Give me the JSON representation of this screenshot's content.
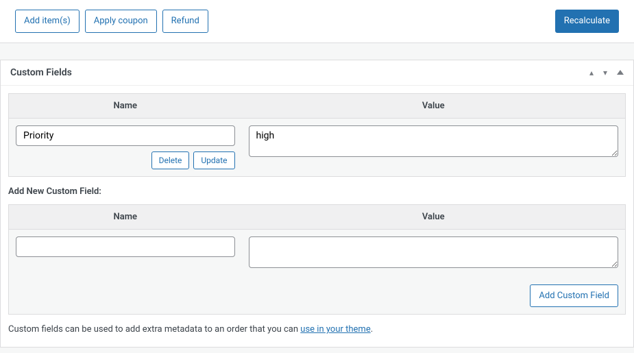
{
  "toolbar": {
    "add_items": "Add item(s)",
    "apply_coupon": "Apply coupon",
    "refund": "Refund",
    "recalculate": "Recalculate"
  },
  "custom_fields": {
    "panel_title": "Custom Fields",
    "headers": {
      "name": "Name",
      "value": "Value"
    },
    "rows": [
      {
        "name": "Priority",
        "value": "high"
      }
    ],
    "row_actions": {
      "delete": "Delete",
      "update": "Update"
    },
    "add_new_label": "Add New Custom Field:",
    "new_row": {
      "name": "",
      "value": ""
    },
    "add_button": "Add Custom Field",
    "help_prefix": "Custom fields can be used to add extra metadata to an order that you can ",
    "help_link": "use in your theme",
    "help_suffix": "."
  }
}
